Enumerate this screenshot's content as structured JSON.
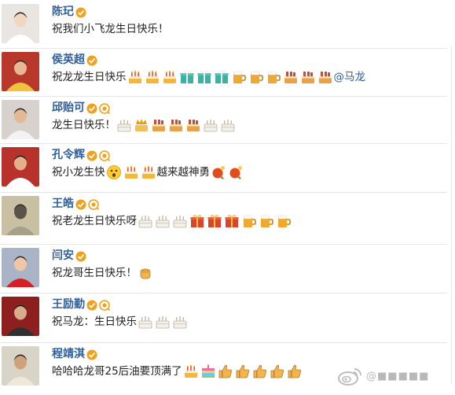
{
  "colors": {
    "name": "#2f5f9b",
    "badge_verified": "#f0a21d",
    "text": "#222222"
  },
  "feed": [
    {
      "name": "陈玘",
      "badges": [
        "verified-icon"
      ],
      "message": [
        {
          "type": "text",
          "value": "祝我们小飞龙生日快乐！"
        }
      ]
    },
    {
      "name": "侯英超",
      "badges": [
        "verified-icon"
      ],
      "message": [
        {
          "type": "text",
          "value": "祝龙龙生日快乐"
        },
        {
          "type": "emoji",
          "icon": "cake-emoji"
        },
        {
          "type": "emoji",
          "icon": "cake-emoji"
        },
        {
          "type": "emoji",
          "icon": "cake-emoji"
        },
        {
          "type": "emoji",
          "icon": "gift-emoji"
        },
        {
          "type": "emoji",
          "icon": "gift-emoji"
        },
        {
          "type": "emoji",
          "icon": "gift-emoji"
        },
        {
          "type": "emoji",
          "icon": "beer-emoji"
        },
        {
          "type": "emoji",
          "icon": "beer-emoji"
        },
        {
          "type": "emoji",
          "icon": "beer-emoji"
        },
        {
          "type": "emoji",
          "icon": "candle-cake-emoji"
        },
        {
          "type": "emoji",
          "icon": "candle-cake-emoji"
        },
        {
          "type": "emoji",
          "icon": "candle-cake-emoji"
        },
        {
          "type": "mention",
          "value": "@马龙"
        }
      ]
    },
    {
      "name": "邱贻可",
      "badges": [
        "verified-icon",
        "star-badge-icon"
      ],
      "message": [
        {
          "type": "text",
          "value": "龙生日快乐！"
        },
        {
          "type": "emoji",
          "icon": "white-cake-emoji"
        },
        {
          "type": "emoji",
          "icon": "crown-cake-emoji"
        },
        {
          "type": "emoji",
          "icon": "candle-cake-emoji"
        },
        {
          "type": "emoji",
          "icon": "candle-cake-emoji"
        },
        {
          "type": "emoji",
          "icon": "candle-cake-emoji"
        },
        {
          "type": "emoji",
          "icon": "white-cake-emoji"
        },
        {
          "type": "emoji",
          "icon": "white-cake-emoji"
        }
      ]
    },
    {
      "name": "孔令辉",
      "badges": [
        "verified-icon",
        "star-badge-icon"
      ],
      "message": [
        {
          "type": "text",
          "value": "祝小龙生快"
        },
        {
          "type": "emoji",
          "icon": "surprised-face-emoji"
        },
        {
          "type": "emoji",
          "icon": "cake-emoji"
        },
        {
          "type": "emoji",
          "icon": "cake-emoji"
        },
        {
          "type": "text",
          "value": "越来越神勇"
        },
        {
          "type": "emoji",
          "icon": "ping-pong-emoji"
        },
        {
          "type": "emoji",
          "icon": "ping-pong-emoji"
        }
      ]
    },
    {
      "name": "王皓",
      "badges": [
        "verified-icon",
        "star-badge-icon"
      ],
      "message": [
        {
          "type": "text",
          "value": "祝老龙生日快乐呀"
        },
        {
          "type": "emoji",
          "icon": "white-cake-emoji"
        },
        {
          "type": "emoji",
          "icon": "white-cake-emoji"
        },
        {
          "type": "emoji",
          "icon": "white-cake-emoji"
        },
        {
          "type": "emoji",
          "icon": "gift-red-emoji"
        },
        {
          "type": "emoji",
          "icon": "gift-red-emoji"
        },
        {
          "type": "emoji",
          "icon": "gift-red-emoji"
        },
        {
          "type": "emoji",
          "icon": "beer-emoji"
        },
        {
          "type": "emoji",
          "icon": "beer-emoji"
        },
        {
          "type": "emoji",
          "icon": "beer-emoji"
        }
      ]
    },
    {
      "name": "闫安",
      "badges": [
        "verified-icon"
      ],
      "message": [
        {
          "type": "text",
          "value": "祝龙哥生日快乐！"
        },
        {
          "type": "emoji",
          "icon": "fist-emoji"
        }
      ]
    },
    {
      "name": "王励勤",
      "badges": [
        "verified-icon",
        "star-badge-icon"
      ],
      "message": [
        {
          "type": "text",
          "value": "祝马龙：生日快乐"
        },
        {
          "type": "emoji",
          "icon": "white-cake-emoji"
        },
        {
          "type": "emoji",
          "icon": "white-cake-emoji"
        },
        {
          "type": "emoji",
          "icon": "white-cake-emoji"
        }
      ]
    },
    {
      "name": "程靖淇",
      "badges": [
        "verified-icon"
      ],
      "message": [
        {
          "type": "text",
          "value": "哈哈哈龙哥25后油要顶满了"
        },
        {
          "type": "emoji",
          "icon": "cake-emoji"
        },
        {
          "type": "emoji",
          "icon": "rainbow-cake-emoji"
        },
        {
          "type": "emoji",
          "icon": "thumbs-up-emoji"
        },
        {
          "type": "emoji",
          "icon": "thumbs-up-emoji"
        },
        {
          "type": "emoji",
          "icon": "thumbs-up-emoji"
        },
        {
          "type": "emoji",
          "icon": "thumbs-up-emoji"
        },
        {
          "type": "emoji",
          "icon": "thumbs-up-emoji"
        }
      ]
    }
  ],
  "watermark": {
    "logo": "weibo-logo-icon",
    "text": "@■■■■■"
  }
}
